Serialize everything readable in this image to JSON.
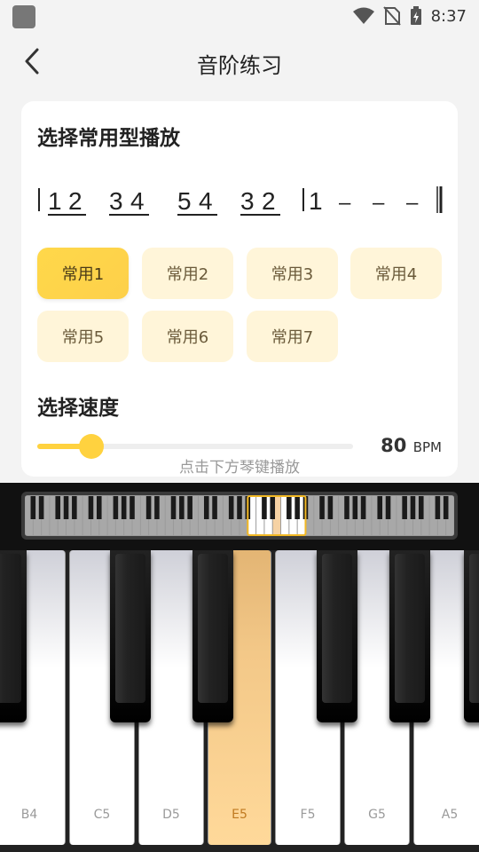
{
  "status_bar": {
    "time": "8:37"
  },
  "nav": {
    "title": "音阶练习"
  },
  "card": {
    "pattern_title": "选择常用型播放",
    "score": {
      "groups": [
        {
          "a": "1",
          "b": "2"
        },
        {
          "a": "3",
          "b": "4"
        },
        {
          "a": "5",
          "b": "4"
        },
        {
          "a": "3",
          "b": "2"
        }
      ],
      "end_note": "1",
      "dashes": [
        "–",
        "–",
        "–"
      ]
    },
    "modes": [
      "常用1",
      "常用2",
      "常用3",
      "常用4",
      "常用5",
      "常用6",
      "常用7"
    ],
    "active_mode_index": 0,
    "speed_title": "选择速度",
    "bpm_value": "80",
    "bpm_unit": "BPM",
    "speed_fraction": 0.17,
    "hint": "点击下方琴键播放"
  },
  "piano": {
    "white_keys": [
      "B4",
      "C5",
      "D5",
      "E5",
      "F5",
      "G5",
      "A5"
    ],
    "pressed_key": "E5"
  },
  "colors": {
    "accent": "#ffd23f",
    "button_bg": "#fff5d9",
    "pressed_key": "#ffd99a"
  }
}
